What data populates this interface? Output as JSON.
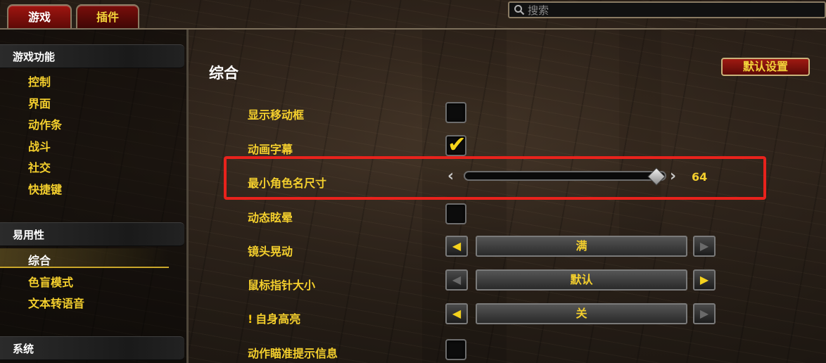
{
  "tabs": [
    {
      "label": "游戏",
      "active": true
    },
    {
      "label": "插件",
      "active": false
    }
  ],
  "search": {
    "placeholder": "搜索",
    "icon": "search-icon"
  },
  "sidebar": {
    "sections": [
      {
        "header": "游戏功能",
        "items": [
          "控制",
          "界面",
          "动作条",
          "战斗",
          "社交",
          "快捷键"
        ]
      },
      {
        "header": "易用性",
        "items": [
          "综合",
          "色盲模式",
          "文本转语音"
        ],
        "selected": "综合"
      },
      {
        "header": "系统",
        "items": []
      }
    ]
  },
  "main": {
    "title": "综合",
    "default_button": "默认设置",
    "options": {
      "show_move_frame": {
        "label": "显示移动框",
        "checked": false
      },
      "animated_subtitles": {
        "label": "动画字幕",
        "checked": true
      },
      "min_name_size": {
        "label": "最小角色名尺寸",
        "value": "64"
      },
      "motion_sickness": {
        "label": "动态眩晕",
        "checked": false
      },
      "camera_shake": {
        "label": "镜头晃动",
        "value": "满"
      },
      "cursor_size": {
        "label": "鼠标指针大小",
        "value": "默认"
      },
      "self_highlight": {
        "label": "自身高亮",
        "value": "关",
        "warning_icon": "exclamation-icon"
      },
      "aim_hint": {
        "label": "动作瞄准提示信息",
        "checked": false
      }
    }
  },
  "colors": {
    "accent": "#f4cf2d",
    "highlight_box": "#e8221c",
    "tab_red": "#8b0f0b"
  }
}
